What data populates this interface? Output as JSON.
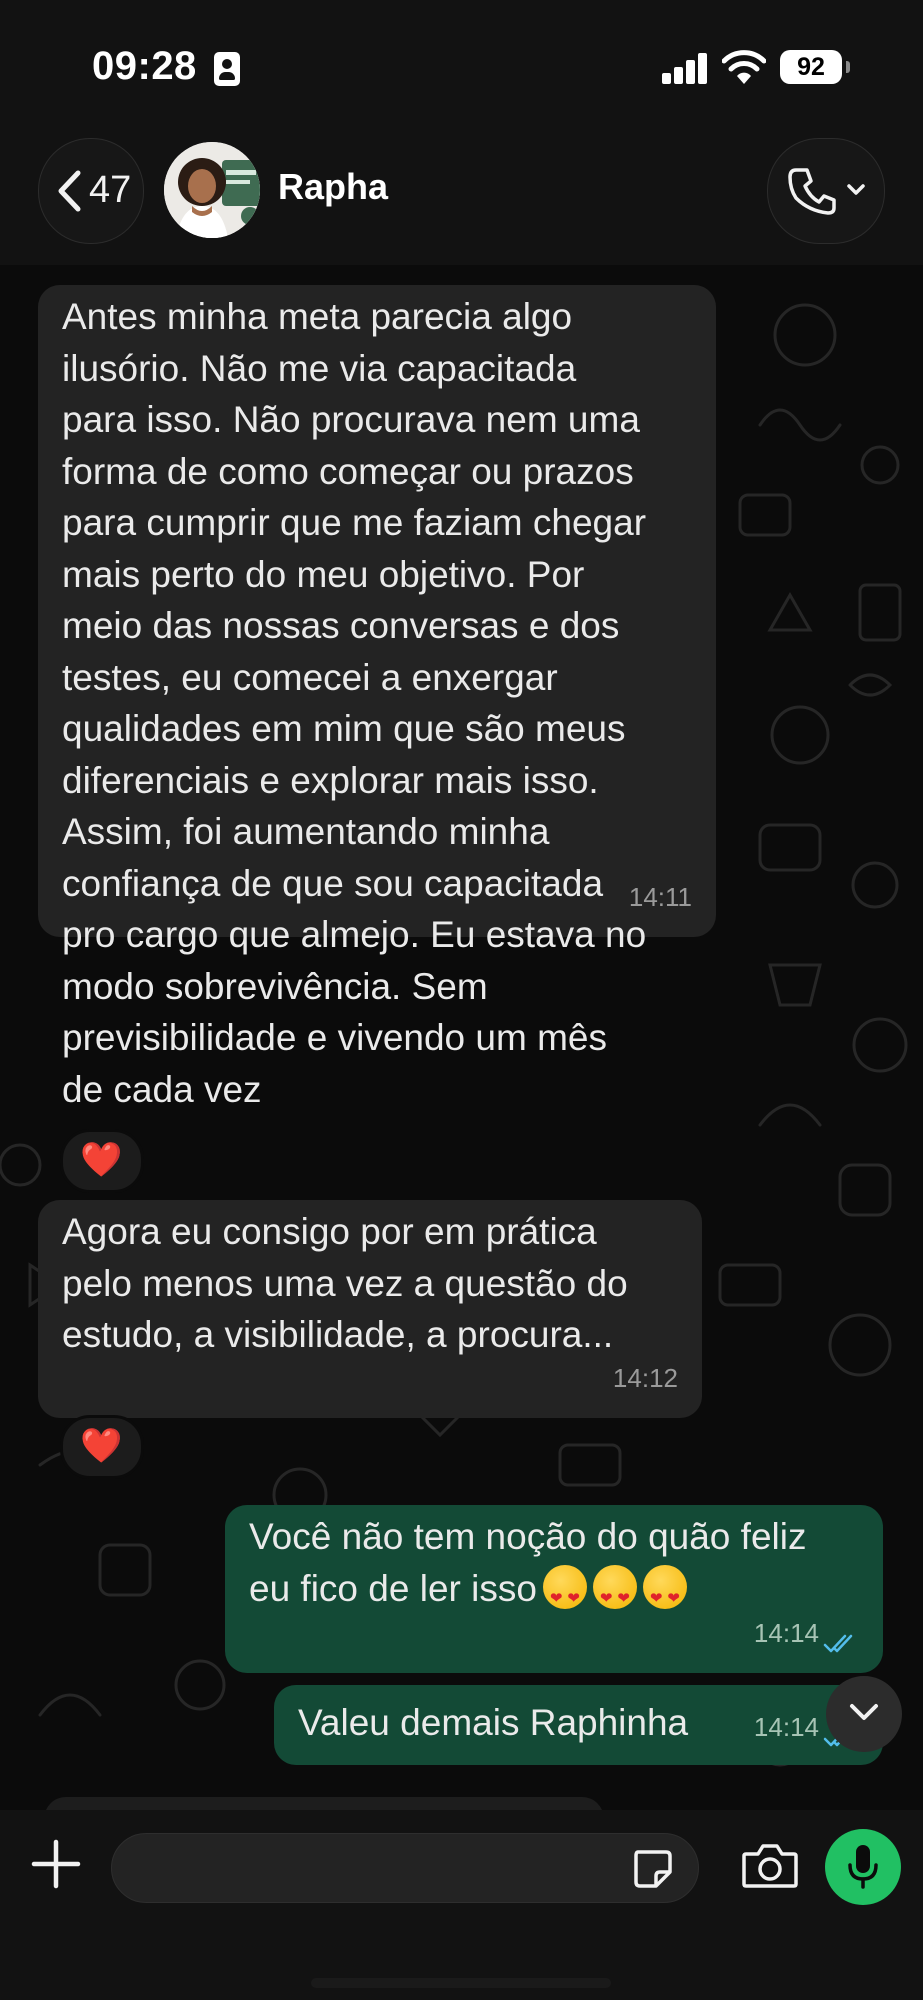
{
  "status_bar": {
    "time": "09:28",
    "battery": "92"
  },
  "header": {
    "back_count": "47",
    "contact_name": "Rapha"
  },
  "messages": [
    {
      "direction": "incoming",
      "text": "Antes minha meta parecia algo\nilusório. Não me via capacitada\npara isso. Não procurava nem uma\nforma de como começar ou prazos\npara cumprir que me faziam chegar\nmais perto do meu objetivo. Por\nmeio das nossas conversas e dos\ntestes, eu comecei a enxergar\nqualidades em mim que são meus\ndiferenciais e explorar mais isso.\nAssim, foi aumentando minha\nconfiança de que sou capacitada\npro cargo que almejo. Eu estava no\nmodo sobrevivência. Sem\nprevisibilidade e vivendo um mês\nde cada vez",
      "time": "14:11",
      "reaction": "❤️"
    },
    {
      "direction": "incoming",
      "text": "Agora eu consigo por em prática\npelo menos uma vez a questão do\nestudo, a visibilidade, a procura...",
      "time": "14:12",
      "reaction": "❤️"
    },
    {
      "direction": "outgoing",
      "text": "Você não tem noção do quão feliz\neu fico de ler isso",
      "emoji_count": 3,
      "emoji_icon": "heart-eyes-emoji-icon",
      "time": "14:14",
      "status": "read"
    },
    {
      "direction": "outgoing",
      "text": "Valeu demais Raphinha",
      "time": "14:14",
      "status": "read"
    }
  ],
  "input": {
    "placeholder": ""
  },
  "colors": {
    "incoming_bubble": "#232323",
    "outgoing_bubble": "#134a36",
    "read_ticks": "#53bdeb",
    "mic_button": "#21c063",
    "background": "#0b0b0b"
  }
}
